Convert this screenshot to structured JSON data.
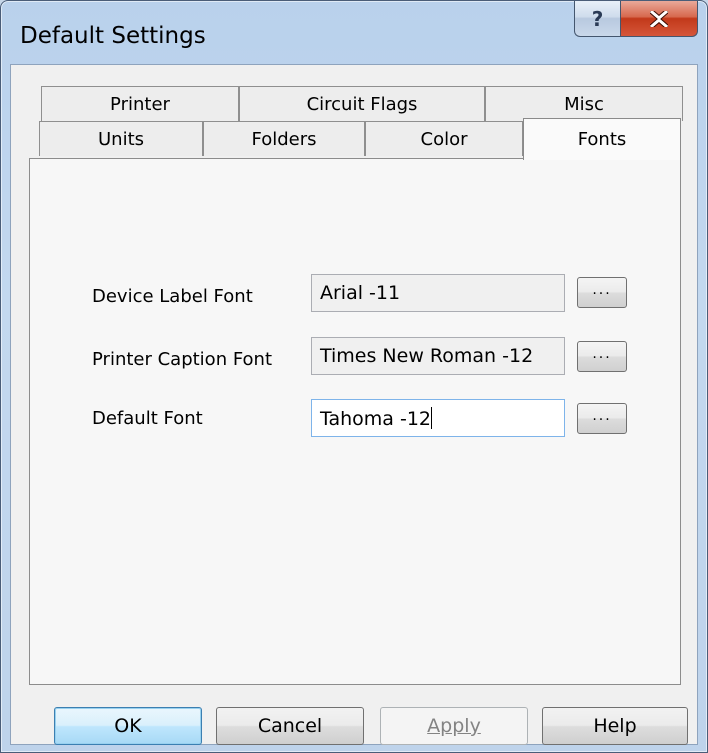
{
  "window": {
    "title": "Default Settings",
    "help_glyph": "?",
    "close_glyph": "X"
  },
  "tabs": {
    "row1": [
      "Printer",
      "Circuit Flags",
      "Misc"
    ],
    "row2": [
      "Units",
      "Folders",
      "Color",
      "Fonts"
    ],
    "active": "Fonts"
  },
  "fonts_panel": {
    "rows": [
      {
        "label": "Device Label Font",
        "value": "Arial -11",
        "browse": "..."
      },
      {
        "label": "Printer Caption Font",
        "value": "Times New Roman -12",
        "browse": "..."
      },
      {
        "label": "Default Font",
        "value": "Tahoma -12",
        "browse": "..."
      }
    ]
  },
  "buttons": {
    "ok": "OK",
    "cancel": "Cancel",
    "apply": "Apply",
    "help": "Help"
  },
  "icons": [
    "help-icon",
    "close-icon"
  ]
}
